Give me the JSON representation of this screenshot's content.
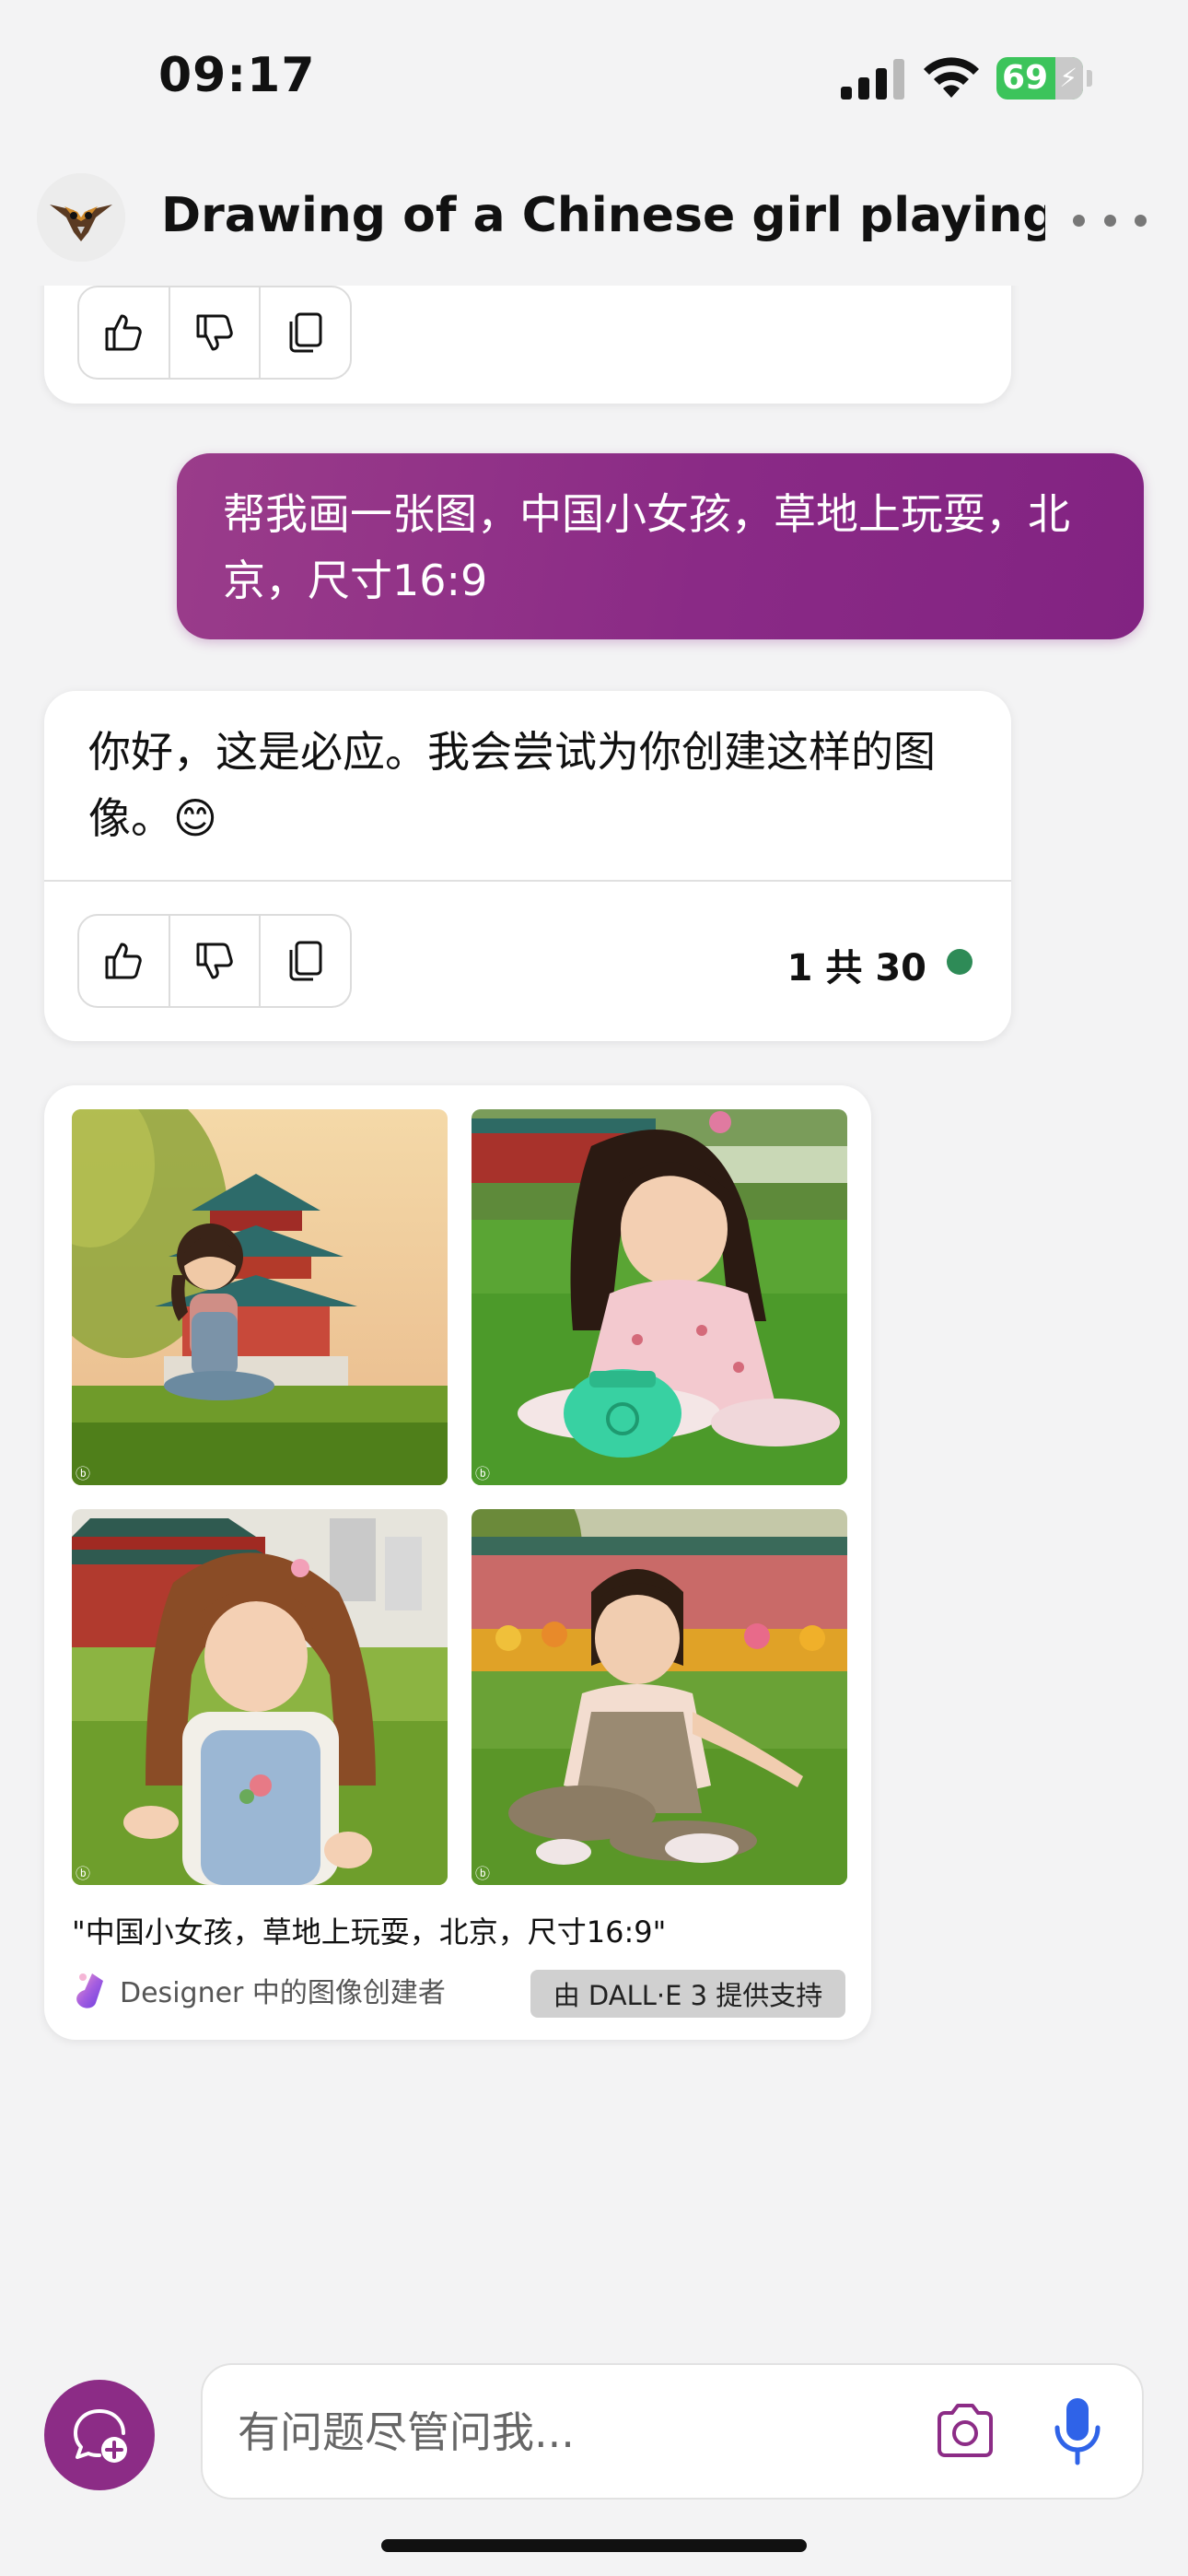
{
  "status_bar": {
    "time": "09:17",
    "battery": "69",
    "icons": [
      "cellular-signal-icon",
      "wifi-icon",
      "battery-charging-icon"
    ]
  },
  "header": {
    "title": "Drawing of a Chinese girl playing on...",
    "icons": [
      "copilot-avatar-icon",
      "more-options-icon"
    ]
  },
  "messages": {
    "user_prompt": "帮我画一张图，中国小女孩，草地上玩耍，北京，尺寸16:9",
    "assistant_reply": "你好，这是必应。我会尝试为你创建这样的图像。😊",
    "page_count": "1 共 30",
    "reaction_icons": [
      "thumbs-up-icon",
      "thumbs-down-icon",
      "copy-icon"
    ]
  },
  "image_card": {
    "caption": "\"中国小女孩，草地上玩耍，北京，尺寸16:9\"",
    "designer_label": "Designer 中的图像创建者",
    "powered_by": "由 DALL·E 3 提供支持",
    "image_tag": "ⓑ"
  },
  "composer": {
    "placeholder": "有问题尽管问我..."
  },
  "colors": {
    "accent": "#8c2c86",
    "status_green": "#2e8b57",
    "mic_blue": "#2f63e8",
    "battery_green": "#3cc45b"
  }
}
